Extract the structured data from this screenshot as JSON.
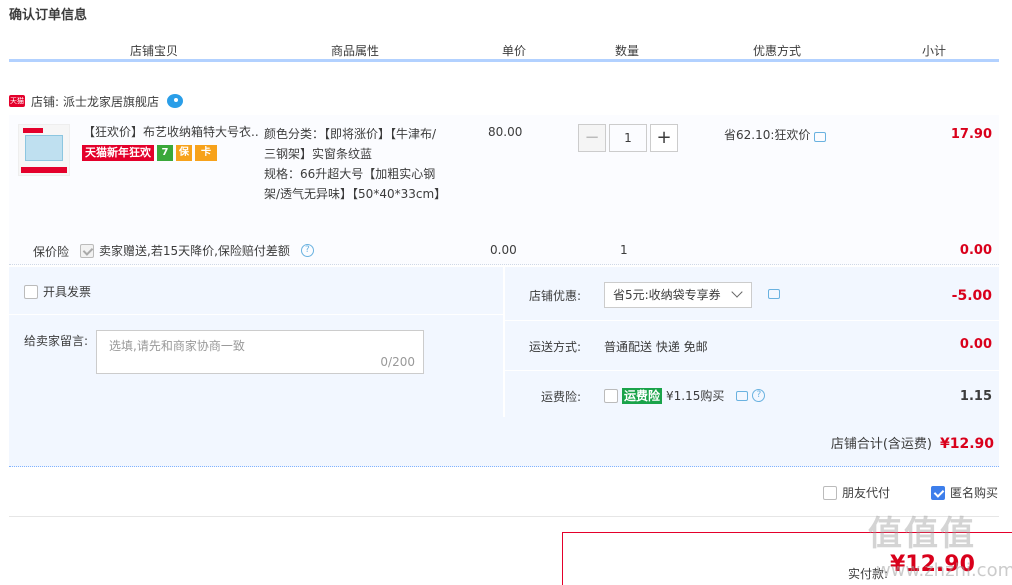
{
  "page_title": "确认订单信息",
  "columns": [
    "店铺宝贝",
    "商品属性",
    "单价",
    "数量",
    "优惠方式",
    "小计"
  ],
  "shop": {
    "label": "店铺:",
    "name": "派士龙家居旗舰店",
    "badge": "天猫"
  },
  "item": {
    "name": "【狂欢价】布艺收纳箱特大号衣...",
    "promo_tag": "天猫新年狂欢",
    "promo_icons": [
      "7",
      "保",
      "卡"
    ],
    "attr_color": "颜色分类：【即将涨价】【牛津布/三钢架】实窗条纹蓝",
    "attr_spec": "规格：66升超大号【加粗实心钢架/透气无异味】【50*40*33cm】",
    "price": "80.00",
    "qty_minus": "−",
    "qty_value": "1",
    "qty_plus": "+",
    "discount": "省62.10:狂欢价",
    "subtotal": "17.90"
  },
  "insurance": {
    "label": "保价险",
    "desc": "卖家赠送,若15天降价,保险赔付差额",
    "help": "?",
    "price": "0.00",
    "qty": "1",
    "subtotal": "0.00"
  },
  "invoice": {
    "label": "开具发票"
  },
  "message": {
    "label": "给卖家留言:",
    "placeholder": "选填,请先和商家协商一致",
    "count": "0/200"
  },
  "shop_discount": {
    "label": "店铺优惠:",
    "value": "省5元:收纳袋专享券",
    "amount": "-5.00"
  },
  "shipping": {
    "label": "运送方式:",
    "value": "普通配送 快递 免邮",
    "amount": "0.00"
  },
  "freight_insurance": {
    "label": "运费险:",
    "tag": "运费险",
    "price": "¥1.15购买",
    "help": "?",
    "amount": "1.15"
  },
  "shop_total": {
    "label": "店铺合计(含运费)",
    "value": "¥12.90"
  },
  "options": {
    "friend_pay": "朋友代付",
    "anonymous": "匿名购买"
  },
  "pay": {
    "label": "实付款:",
    "value": "¥12.90"
  },
  "watermark": {
    "text": "值值值",
    "url": "www.zhzhi.com"
  },
  "colors": {
    "price_red": "#d9001b",
    "header_line": "#b2d1ff",
    "panel_bg": "#f2f7ff",
    "accent_blue": "#3d7eeb"
  }
}
